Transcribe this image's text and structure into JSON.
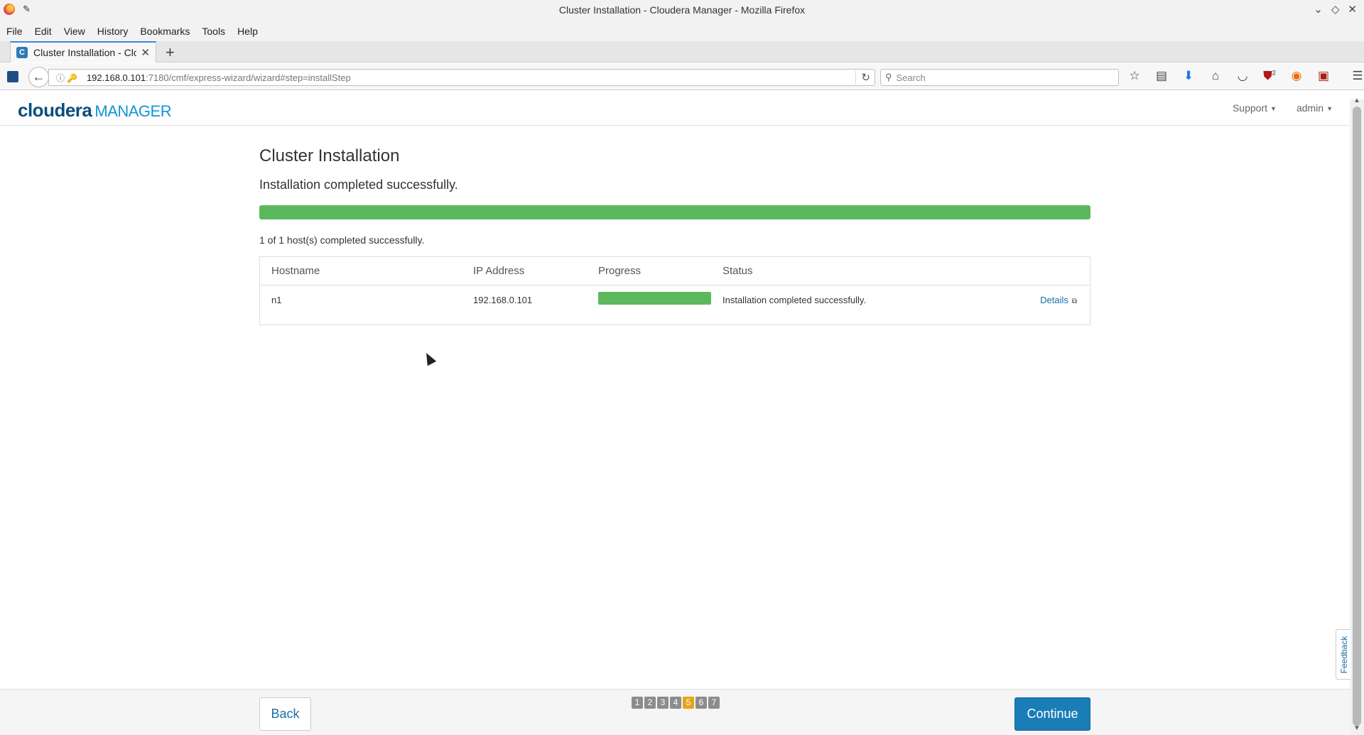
{
  "window": {
    "title": "Cluster Installation - Cloudera Manager - Mozilla Firefox",
    "controls": [
      "⌄",
      "◇",
      "✕"
    ]
  },
  "menu": [
    "File",
    "Edit",
    "View",
    "History",
    "Bookmarks",
    "Tools",
    "Help"
  ],
  "tab": {
    "favicon": "C",
    "label": "Cluster Installation - Clou",
    "close": "✕",
    "new_tab": "+"
  },
  "nav": {
    "url_host": "192.168.0.101",
    "url_path": ":7180/cmf/express-wizard/wizard#step=installStep",
    "search_placeholder": "Search",
    "icons": [
      "star-icon",
      "reading-list-icon",
      "download-icon",
      "home-icon",
      "pocket-icon",
      "ublock-icon",
      "extension-orange-icon",
      "extension-red-icon",
      "menu-icon"
    ],
    "ublock_badge": "2"
  },
  "header": {
    "brand": "cloudera",
    "product": "MANAGER",
    "support": "Support",
    "user": "admin"
  },
  "main": {
    "title": "Cluster Installation",
    "subtitle": "Installation completed successfully.",
    "progress": 1.0,
    "summary": "1 of 1 host(s) completed successfully.",
    "columns": [
      "Hostname",
      "IP Address",
      "Progress",
      "Status"
    ],
    "rows": [
      {
        "hostname": "n1",
        "ip": "192.168.0.101",
        "progress": 1.0,
        "status": "Installation completed successfully.",
        "details": "Details"
      }
    ]
  },
  "feedback": "Feedback",
  "footer": {
    "back": "Back",
    "continue": "Continue",
    "steps": [
      "1",
      "2",
      "3",
      "4",
      "5",
      "6",
      "7"
    ],
    "active_step": "5"
  },
  "colors": {
    "success_green": "#5cb85c",
    "primary_blue": "#1b7db8",
    "active_step": "#e4a51a"
  }
}
